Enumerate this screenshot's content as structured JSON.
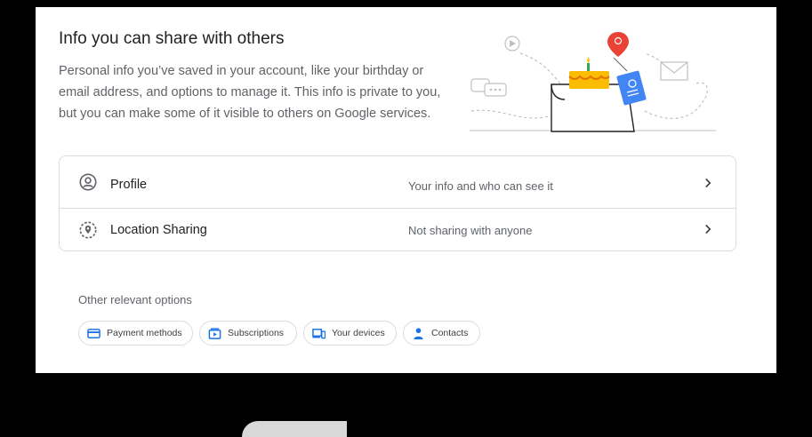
{
  "section": {
    "title": "Info you can share with others",
    "description": "Personal info you’ve saved in your account, like your birthday or email address, and options to manage it. This info is private to you, but you can make some of it visible to others on Google services."
  },
  "rows": [
    {
      "label": "Profile",
      "value": "Your info and who can see it",
      "icon": "account-circle-icon"
    },
    {
      "label": "Location Sharing",
      "value": "Not sharing with anyone",
      "icon": "location-sharing-icon"
    }
  ],
  "other": {
    "label": "Other relevant options",
    "chips": [
      {
        "label": "Payment methods",
        "icon": "credit-card-icon"
      },
      {
        "label": "Subscriptions",
        "icon": "subscriptions-icon"
      },
      {
        "label": "Your devices",
        "icon": "devices-icon"
      },
      {
        "label": "Contacts",
        "icon": "person-icon"
      }
    ]
  },
  "colors": {
    "blue": "#1a73e8",
    "text": "#202124",
    "secondary_text": "#5f6368",
    "border": "#dadce0"
  }
}
